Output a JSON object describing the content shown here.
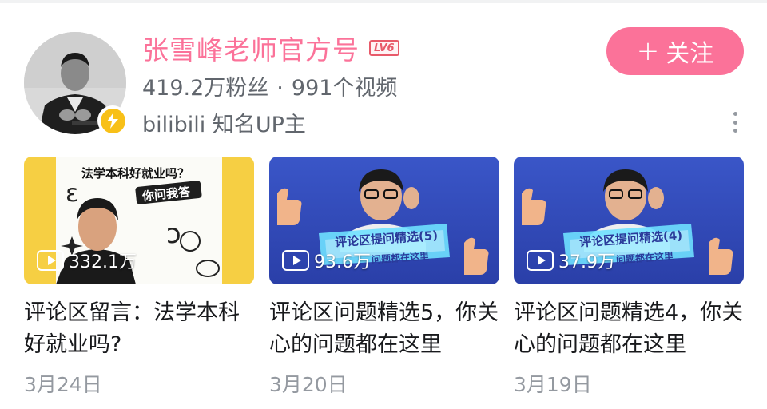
{
  "colors": {
    "accent": "#fb7299",
    "muted": "#61666d",
    "date": "#9499a0",
    "verify": "#f8c018"
  },
  "profile": {
    "name": "张雪峰老师官方号",
    "level": "LV6",
    "followers": "419.2万粉丝",
    "separator": "·",
    "videos": "991个视频",
    "tag": "bilibili 知名UP主",
    "avatar_icon": "person-photo",
    "verify_icon": "lightning-icon"
  },
  "follow_button": {
    "plus": "+",
    "label": "关注"
  },
  "more_icon": "more-vertical-icon",
  "videos": [
    {
      "thumb_text_1": "法学本科好就业吗？",
      "thumb_text_2": "你问我答",
      "plays": "332.1万",
      "title": "评论区留言：法学本科好就业吗?",
      "date": "3月24日"
    },
    {
      "thumb_text_1": "评论区提问精选(5)",
      "thumb_text_2": "问题都在这里",
      "plays": "93.6万",
      "title": "评论区问题精选5，你关心的问题都在这里",
      "date": "3月20日"
    },
    {
      "thumb_text_1": "评论区提问精选(4)",
      "thumb_text_2": "问题都在这里",
      "plays": "37.9万",
      "title": "评论区问题精选4，你关心的问题都在这里",
      "date": "3月19日"
    }
  ]
}
